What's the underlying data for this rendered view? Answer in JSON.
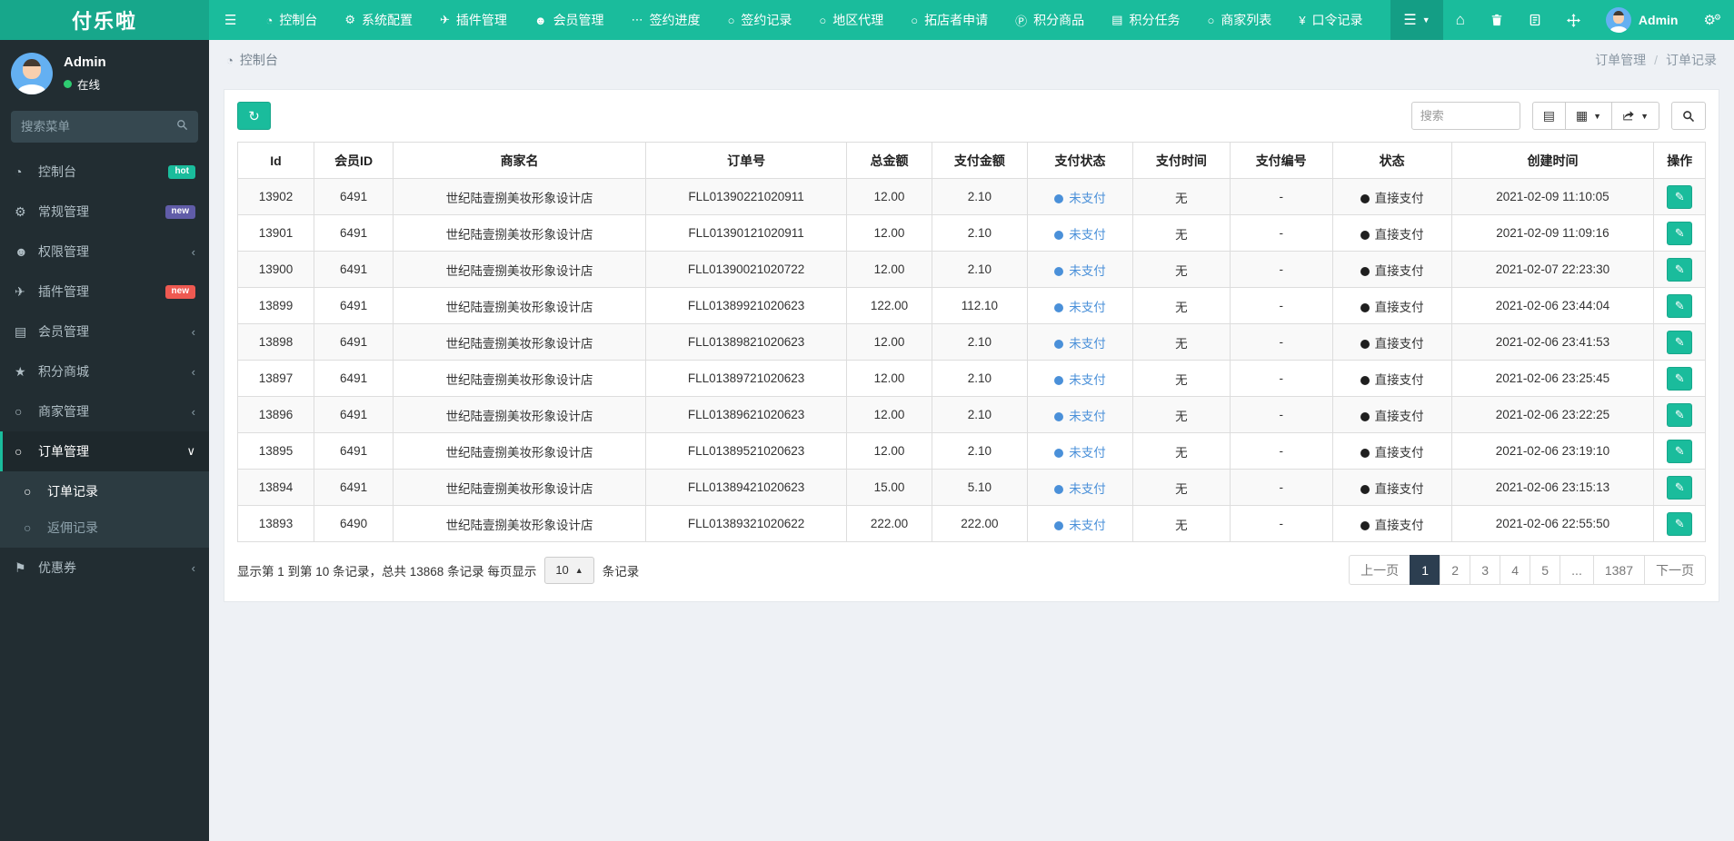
{
  "brand": "付乐啦",
  "colors": {
    "navbar": "#1abc9c",
    "navbar_brand": "#17a78b",
    "navbar_active": "#149e85",
    "sidebar": "#222d32",
    "sidebar_active_border": "#1abc9c",
    "badge_hot": "#1abc9c",
    "badge_new_purple": "#605ca8",
    "badge_new_red": "#ee5951",
    "pay_status_blue": "#4a90d9",
    "accent": "#1abc9c",
    "pagination_active": "#2c3e50"
  },
  "topnav": {
    "items": [
      {
        "name": "console",
        "icon": "dashboard-icon",
        "glyph": "◔",
        "label": "控制台"
      },
      {
        "name": "system-config",
        "icon": "gear-icon",
        "glyph": "⚙",
        "label": "系统配置"
      },
      {
        "name": "plugin",
        "icon": "paper-plane-icon",
        "glyph": "✈",
        "label": "插件管理"
      },
      {
        "name": "member",
        "icon": "user-icon",
        "glyph": "☻",
        "label": "会员管理"
      },
      {
        "name": "sign-progress",
        "icon": "ellipsis-icon",
        "glyph": "⋯",
        "label": "签约进度"
      },
      {
        "name": "sign-record",
        "icon": "circle-icon",
        "glyph": "○",
        "label": "签约记录"
      },
      {
        "name": "region-agent",
        "icon": "circle-icon",
        "glyph": "○",
        "label": "地区代理"
      },
      {
        "name": "store-apply",
        "icon": "circle-icon",
        "glyph": "○",
        "label": "拓店者申请"
      },
      {
        "name": "points-product",
        "icon": "points-icon",
        "glyph": "Ⓟ",
        "label": "积分商品"
      },
      {
        "name": "points-task",
        "icon": "tasks-icon",
        "glyph": "▤",
        "label": "积分任务"
      },
      {
        "name": "merchant-list",
        "icon": "circle-icon",
        "glyph": "○",
        "label": "商家列表"
      },
      {
        "name": "password-record",
        "icon": "yen-icon",
        "glyph": "¥",
        "label": "口令记录"
      }
    ],
    "user": {
      "name": "Admin"
    }
  },
  "sidebar": {
    "user": {
      "name": "Admin",
      "status": "在线"
    },
    "search_placeholder": "搜索菜单",
    "menu": [
      {
        "name": "console",
        "icon": "dashboard-icon",
        "glyph": "◔",
        "label": "控制台",
        "badge": {
          "text": "hot",
          "color": "#1abc9c"
        }
      },
      {
        "name": "general",
        "icon": "gears-icon",
        "glyph": "⚙",
        "label": "常规管理",
        "badge": {
          "text": "new",
          "color": "#605ca8"
        }
      },
      {
        "name": "permission",
        "icon": "users-icon",
        "glyph": "☻",
        "label": "权限管理",
        "chevron": true
      },
      {
        "name": "plugin",
        "icon": "paper-plane-icon",
        "glyph": "✈",
        "label": "插件管理",
        "badge": {
          "text": "new",
          "color": "#ee5951"
        }
      },
      {
        "name": "member",
        "icon": "list-icon",
        "glyph": "▤",
        "label": "会员管理",
        "chevron": true
      },
      {
        "name": "points-mall",
        "icon": "star-icon",
        "glyph": "★",
        "label": "积分商城",
        "chevron": true
      },
      {
        "name": "merchant",
        "icon": "circle-icon",
        "glyph": "○",
        "label": "商家管理",
        "chevron": true
      },
      {
        "name": "order",
        "icon": "circle-icon",
        "glyph": "○",
        "label": "订单管理",
        "active": true,
        "expanded": true,
        "children": [
          {
            "name": "order-record",
            "icon": "circle-icon",
            "glyph": "○",
            "label": "订单记录",
            "active": true
          },
          {
            "name": "rebate-record",
            "icon": "circle-icon",
            "glyph": "○",
            "label": "返佣记录",
            "active": false
          }
        ]
      },
      {
        "name": "coupon",
        "icon": "bookmark-icon",
        "glyph": "⚑",
        "label": "优惠券",
        "chevron": true
      }
    ]
  },
  "breadcrumb": {
    "left": "控制台",
    "path": [
      "订单管理",
      "订单记录"
    ],
    "separator": "/"
  },
  "toolbar": {
    "search_placeholder": "搜索"
  },
  "table": {
    "columns": [
      "Id",
      "会员ID",
      "商家名",
      "订单号",
      "总金额",
      "支付金额",
      "支付状态",
      "支付时间",
      "支付编号",
      "状态",
      "创建时间",
      "操作"
    ],
    "edit_glyph": "✎",
    "rows": [
      {
        "id": "13902",
        "member_id": "6491",
        "merchant": "世纪陆壹捌美妆形象设计店",
        "order_no": "FLL01390221020911",
        "total": "12.00",
        "paid": "2.10",
        "pay_status": "未支付",
        "pay_time": "无",
        "pay_no": "-",
        "status": "直接支付",
        "created": "2021-02-09 11:10:05"
      },
      {
        "id": "13901",
        "member_id": "6491",
        "merchant": "世纪陆壹捌美妆形象设计店",
        "order_no": "FLL01390121020911",
        "total": "12.00",
        "paid": "2.10",
        "pay_status": "未支付",
        "pay_time": "无",
        "pay_no": "-",
        "status": "直接支付",
        "created": "2021-02-09 11:09:16"
      },
      {
        "id": "13900",
        "member_id": "6491",
        "merchant": "世纪陆壹捌美妆形象设计店",
        "order_no": "FLL01390021020722",
        "total": "12.00",
        "paid": "2.10",
        "pay_status": "未支付",
        "pay_time": "无",
        "pay_no": "-",
        "status": "直接支付",
        "created": "2021-02-07 22:23:30"
      },
      {
        "id": "13899",
        "member_id": "6491",
        "merchant": "世纪陆壹捌美妆形象设计店",
        "order_no": "FLL01389921020623",
        "total": "122.00",
        "paid": "112.10",
        "pay_status": "未支付",
        "pay_time": "无",
        "pay_no": "-",
        "status": "直接支付",
        "created": "2021-02-06 23:44:04"
      },
      {
        "id": "13898",
        "member_id": "6491",
        "merchant": "世纪陆壹捌美妆形象设计店",
        "order_no": "FLL01389821020623",
        "total": "12.00",
        "paid": "2.10",
        "pay_status": "未支付",
        "pay_time": "无",
        "pay_no": "-",
        "status": "直接支付",
        "created": "2021-02-06 23:41:53"
      },
      {
        "id": "13897",
        "member_id": "6491",
        "merchant": "世纪陆壹捌美妆形象设计店",
        "order_no": "FLL01389721020623",
        "total": "12.00",
        "paid": "2.10",
        "pay_status": "未支付",
        "pay_time": "无",
        "pay_no": "-",
        "status": "直接支付",
        "created": "2021-02-06 23:25:45"
      },
      {
        "id": "13896",
        "member_id": "6491",
        "merchant": "世纪陆壹捌美妆形象设计店",
        "order_no": "FLL01389621020623",
        "total": "12.00",
        "paid": "2.10",
        "pay_status": "未支付",
        "pay_time": "无",
        "pay_no": "-",
        "status": "直接支付",
        "created": "2021-02-06 23:22:25"
      },
      {
        "id": "13895",
        "member_id": "6491",
        "merchant": "世纪陆壹捌美妆形象设计店",
        "order_no": "FLL01389521020623",
        "total": "12.00",
        "paid": "2.10",
        "pay_status": "未支付",
        "pay_time": "无",
        "pay_no": "-",
        "status": "直接支付",
        "created": "2021-02-06 23:19:10"
      },
      {
        "id": "13894",
        "member_id": "6491",
        "merchant": "世纪陆壹捌美妆形象设计店",
        "order_no": "FLL01389421020623",
        "total": "15.00",
        "paid": "5.10",
        "pay_status": "未支付",
        "pay_time": "无",
        "pay_no": "-",
        "status": "直接支付",
        "created": "2021-02-06 23:15:13"
      },
      {
        "id": "13893",
        "member_id": "6490",
        "merchant": "世纪陆壹捌美妆形象设计店",
        "order_no": "FLL01389321020622",
        "total": "222.00",
        "paid": "222.00",
        "pay_status": "未支付",
        "pay_time": "无",
        "pay_no": "-",
        "status": "直接支付",
        "created": "2021-02-06 22:55:50"
      }
    ]
  },
  "footer": {
    "summary_prefix": "显示第 1 到第 10 条记录，总共 13868 条记录 每页显示",
    "per_page": "10",
    "summary_suffix": "条记录",
    "pagination": {
      "prev": "上一页",
      "pages": [
        "1",
        "2",
        "3",
        "4",
        "5",
        "...",
        "1387"
      ],
      "active": "1",
      "next": "下一页"
    }
  }
}
